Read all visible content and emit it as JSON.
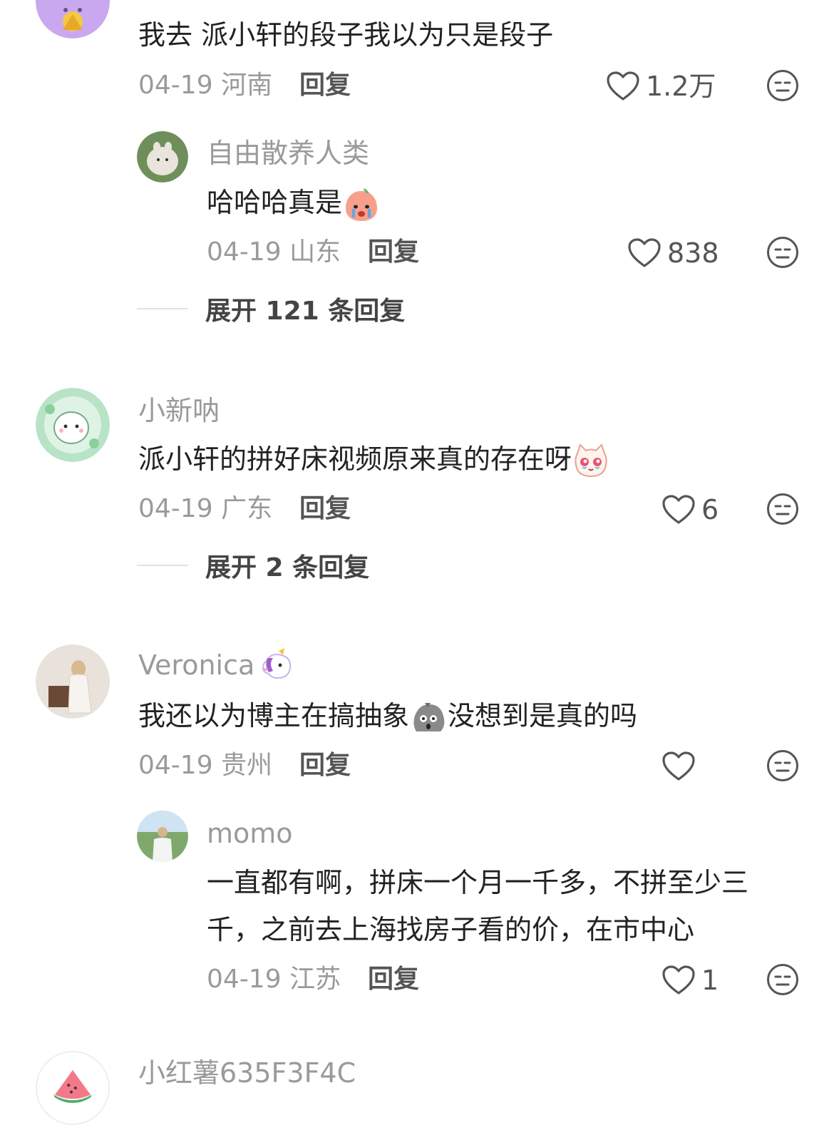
{
  "comments": [
    {
      "username": "",
      "text": "我去 派小轩的段子我以为只是段子",
      "date": "04-19",
      "location": "河南",
      "reply_label": "回复",
      "likes": "1.2万",
      "replies": [
        {
          "username": "自由散养人类",
          "text": "哈哈哈真是",
          "emoji": "crying-peach-emoji",
          "date": "04-19",
          "location": "山东",
          "reply_label": "回复",
          "likes": "838"
        }
      ],
      "expand_label": "展开 121 条回复"
    },
    {
      "username": "小新呐",
      "text": "派小轩的拼好床视频原来真的存在呀",
      "emoji": "teary-cat-emoji",
      "date": "04-19",
      "location": "广东",
      "reply_label": "回复",
      "likes": "6",
      "expand_label": "展开 2 条回复"
    },
    {
      "username": "Veronica",
      "username_emoji": "unicorn-emoji",
      "text_before": "我还以为博主在搞抽象",
      "text_emoji": "shocked-rock-emoji",
      "text_after": "没想到是真的吗",
      "date": "04-19",
      "location": "贵州",
      "reply_label": "回复",
      "likes": "",
      "replies": [
        {
          "username": "momo",
          "text_line1": "一直都有啊，拼床一个月一千多，不拼至少三",
          "text_line2": "千，之前去上海找房子看的价，在市中心",
          "date": "04-19",
          "location": "江苏",
          "reply_label": "回复",
          "likes": "1"
        }
      ]
    },
    {
      "username": "小红薯635F3F4C",
      "avatar_icon": "watermelon-icon"
    }
  ],
  "colors": {
    "meta_gray": "#9a9a9a",
    "text_dark": "#222222",
    "icon_gray": "#555555"
  }
}
